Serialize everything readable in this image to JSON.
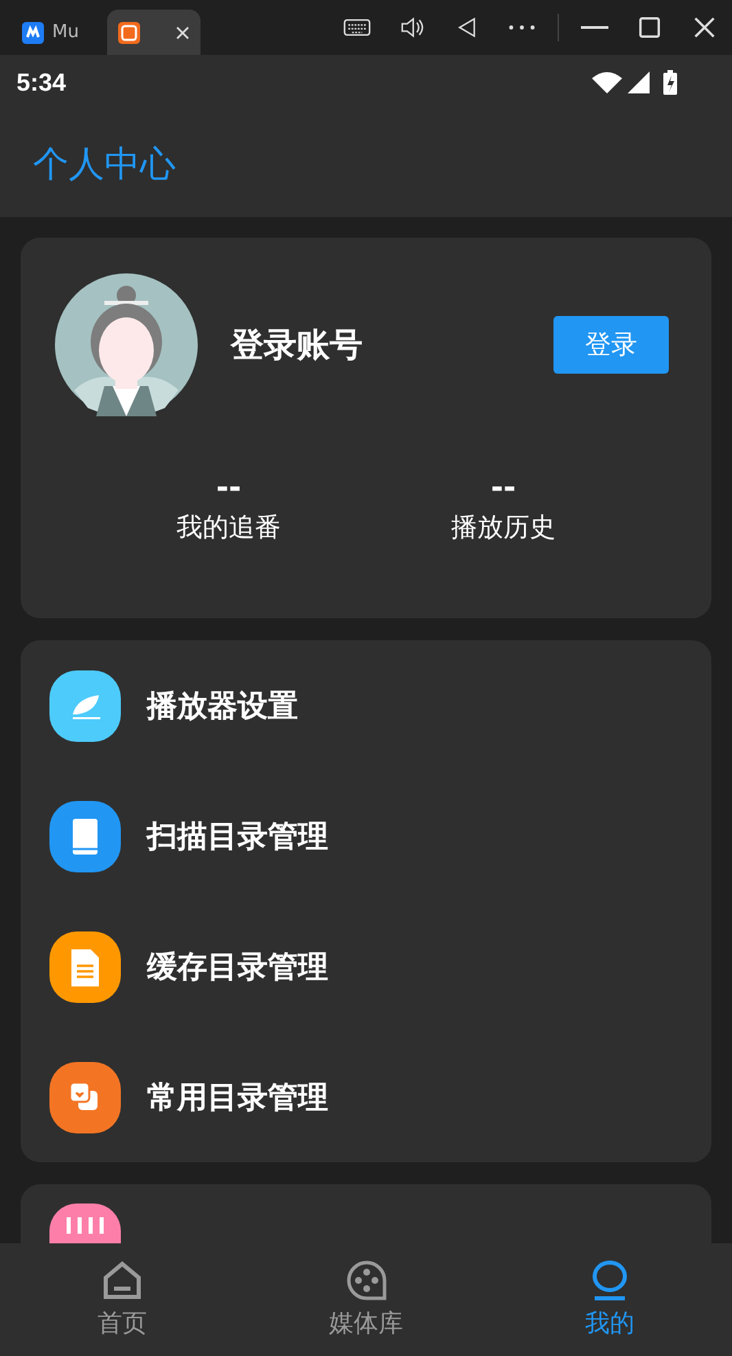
{
  "emulator_bar": {
    "tabs": [
      {
        "label": "Mu",
        "selected": false
      },
      {
        "selected": true
      }
    ]
  },
  "status_bar": {
    "time": "5:34"
  },
  "app_bar": {
    "title": "个人中心"
  },
  "profile": {
    "name": "登录账号",
    "login_button": "登录",
    "stats": [
      {
        "value": "--",
        "label": "我的追番"
      },
      {
        "value": "--",
        "label": "播放历史"
      }
    ]
  },
  "menu": [
    {
      "kind": "feather",
      "label": "播放器设置",
      "color": "#4dcbfb"
    },
    {
      "kind": "book",
      "label": "扫描目录管理",
      "color": "#2196f3"
    },
    {
      "kind": "file",
      "label": "缓存目录管理",
      "color": "#ff9800"
    },
    {
      "kind": "favorite",
      "label": "常用目录管理",
      "color": "#f37524"
    }
  ],
  "menu_2": [
    {
      "kind": "bili",
      "color": "#fd7fa9"
    }
  ],
  "bottom_nav": [
    {
      "kind": "home",
      "label": "首页",
      "selected": false
    },
    {
      "kind": "media",
      "label": "媒体库",
      "selected": false
    },
    {
      "kind": "me",
      "label": "我的",
      "selected": true
    }
  ]
}
